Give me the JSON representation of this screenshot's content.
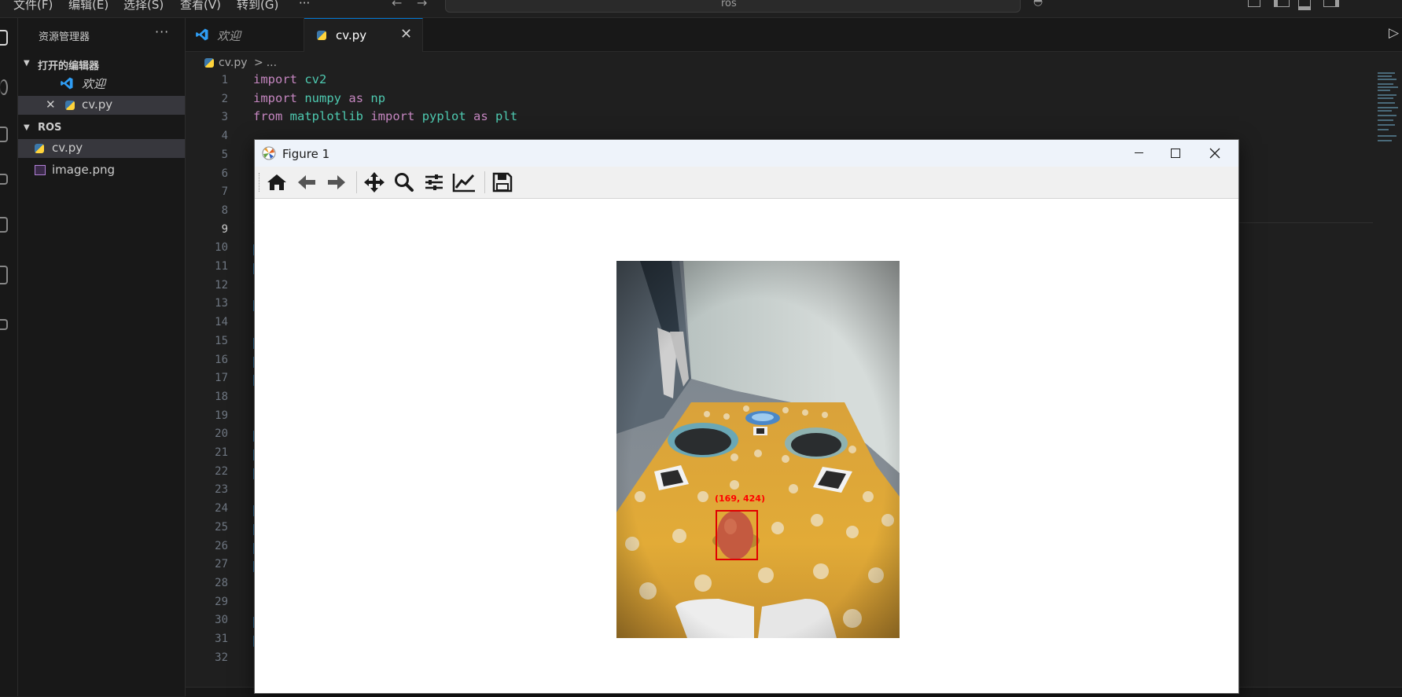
{
  "menubar": {
    "items": [
      "文件(F)",
      "编辑(E)",
      "选择(S)",
      "查看(V)",
      "转到(G)",
      "···"
    ],
    "search": "ros"
  },
  "sidebar": {
    "title": "资源管理器",
    "more": "···",
    "open_editors": {
      "title": "打开的编辑器",
      "items": [
        {
          "label": "欢迎",
          "icon": "vscode-icon"
        },
        {
          "label": "cv.py",
          "icon": "python-icon"
        }
      ]
    },
    "workspace": {
      "title": "ROS",
      "files": [
        {
          "label": "cv.py",
          "icon": "python-icon"
        },
        {
          "label": "image.png",
          "icon": "image-icon"
        }
      ]
    }
  },
  "tabs": [
    {
      "label": "欢迎",
      "icon": "vscode-icon"
    },
    {
      "label": "cv.py",
      "icon": "python-icon",
      "close": "✕"
    }
  ],
  "breadcrumb": {
    "file": "cv.py",
    "sep": ">",
    "rest": "..."
  },
  "editor": {
    "line_numbers": [
      "1",
      "2",
      "3",
      "4",
      "5",
      "6",
      "7",
      "8",
      "9",
      "10",
      "11",
      "12",
      "13",
      "14",
      "15",
      "16",
      "17",
      "18",
      "19",
      "20",
      "21",
      "22",
      "23",
      "24",
      "25",
      "26",
      "27",
      "28",
      "29",
      "30",
      "31",
      "32"
    ],
    "current_line": "9",
    "lines": [
      [
        {
          "t": "import",
          "c": "kw"
        },
        {
          "t": " ",
          "c": "pl"
        },
        {
          "t": "cv2",
          "c": "md"
        }
      ],
      [
        {
          "t": "import",
          "c": "kw"
        },
        {
          "t": " ",
          "c": "pl"
        },
        {
          "t": "numpy",
          "c": "md"
        },
        {
          "t": " ",
          "c": "pl"
        },
        {
          "t": "as",
          "c": "kw"
        },
        {
          "t": " ",
          "c": "pl"
        },
        {
          "t": "np",
          "c": "md"
        }
      ],
      [
        {
          "t": "from",
          "c": "kw"
        },
        {
          "t": " ",
          "c": "pl"
        },
        {
          "t": "matplotlib",
          "c": "md"
        },
        {
          "t": " ",
          "c": "pl"
        },
        {
          "t": "import",
          "c": "kw"
        },
        {
          "t": " ",
          "c": "pl"
        },
        {
          "t": "pyplot",
          "c": "md"
        },
        {
          "t": " ",
          "c": "pl"
        },
        {
          "t": "as",
          "c": "kw"
        },
        {
          "t": " ",
          "c": "pl"
        },
        {
          "t": "plt",
          "c": "md"
        }
      ]
    ]
  },
  "figure": {
    "title": "Figure 1",
    "toolbar": [
      "home-icon",
      "back-arrow-icon",
      "forward-arrow-icon",
      "pan-icon",
      "zoom-icon",
      "configure-subplots-icon",
      "edit-axis-icon",
      "save-icon"
    ],
    "detection_label": "(169, 424)"
  },
  "colors": {
    "accent": "#0078d4",
    "bbox": "#e00000"
  }
}
